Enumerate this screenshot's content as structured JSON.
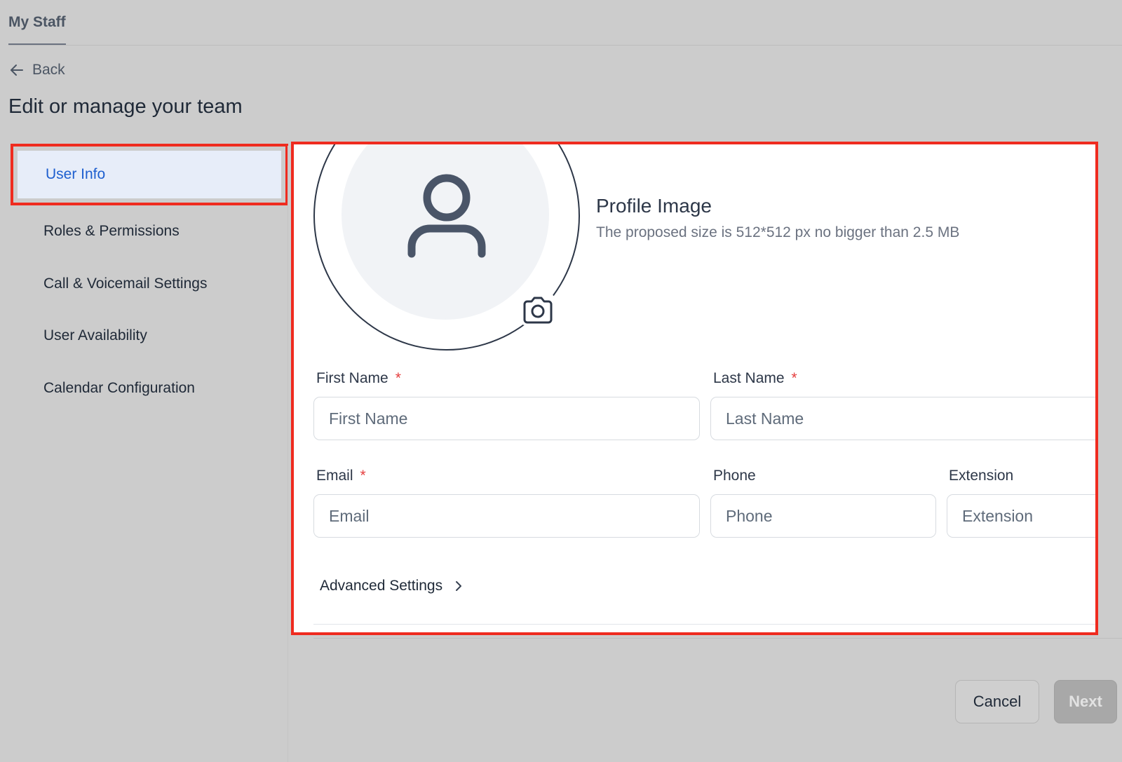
{
  "header": {
    "tab_label": "My Staff",
    "back_label": "Back",
    "page_title": "Edit or manage your team"
  },
  "sidebar": {
    "items": [
      {
        "label": "User Info",
        "active": true
      },
      {
        "label": "Roles & Permissions"
      },
      {
        "label": "Call & Voicemail Settings"
      },
      {
        "label": "User Availability"
      },
      {
        "label": "Calendar Configuration"
      }
    ]
  },
  "profile": {
    "title": "Profile Image",
    "subtitle": "The proposed size is 512*512 px no bigger than 2.5 MB"
  },
  "form": {
    "first_name": {
      "label": "First Name",
      "required_mark": "*",
      "placeholder": "First Name",
      "value": ""
    },
    "last_name": {
      "label": "Last Name",
      "required_mark": "*",
      "placeholder": "Last Name",
      "value": ""
    },
    "email": {
      "label": "Email",
      "required_mark": "*",
      "placeholder": "Email",
      "value": ""
    },
    "phone": {
      "label": "Phone",
      "placeholder": "Phone",
      "value": ""
    },
    "extension": {
      "label": "Extension",
      "placeholder": "Extension",
      "value": ""
    },
    "advanced_label": "Advanced Settings"
  },
  "footer": {
    "cancel_label": "Cancel",
    "next_label": "Next"
  },
  "colors": {
    "highlight": "#ef2b1f",
    "active_nav_bg": "#e7edf9",
    "active_nav_text": "#1e5fcf",
    "required": "#e53e3e"
  },
  "icons": {
    "back": "arrow-left-icon",
    "avatar": "person-icon",
    "camera": "camera-icon",
    "advanced": "chevron-right-icon"
  }
}
